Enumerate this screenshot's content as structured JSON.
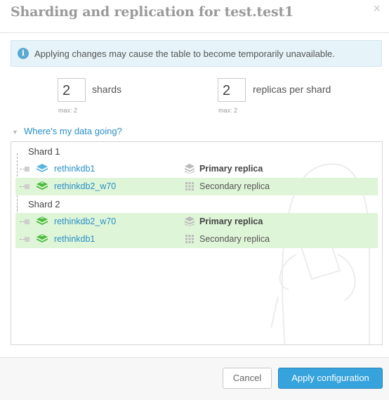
{
  "dialog": {
    "title": "Sharding and replication for test.test1",
    "close_icon": "close-icon"
  },
  "alert": {
    "icon": "info-icon",
    "text": "Applying changes may cause the table to become temporarily unavailable."
  },
  "shards": {
    "value": "2",
    "label": "shards",
    "max": "max: 2"
  },
  "replicas": {
    "value": "2",
    "label": "replicas per shard",
    "max": "max: 2"
  },
  "data_toggle": {
    "label": "Where's my data going?"
  },
  "tree": {
    "shards": [
      {
        "label": "Shard 1",
        "replicas": [
          {
            "server": "rethinkdb1",
            "role": "Primary replica",
            "highlighted": false
          },
          {
            "server": "rethinkdb2_w70",
            "role": "Secondary replica",
            "highlighted": true
          }
        ]
      },
      {
        "label": "Shard 2",
        "replicas": [
          {
            "server": "rethinkdb2_w70",
            "role": "Primary replica",
            "highlighted": true
          },
          {
            "server": "rethinkdb1",
            "role": "Secondary replica",
            "highlighted": true
          }
        ]
      }
    ]
  },
  "colors": {
    "accent": "#36a3dd",
    "link": "#2a8fc7",
    "highlight_row": "#dff5d8",
    "server_icon_blue": "#5bb4e0",
    "server_icon_green": "#4cbb3e"
  },
  "footer": {
    "cancel_label": "Cancel",
    "apply_label": "Apply configuration"
  }
}
